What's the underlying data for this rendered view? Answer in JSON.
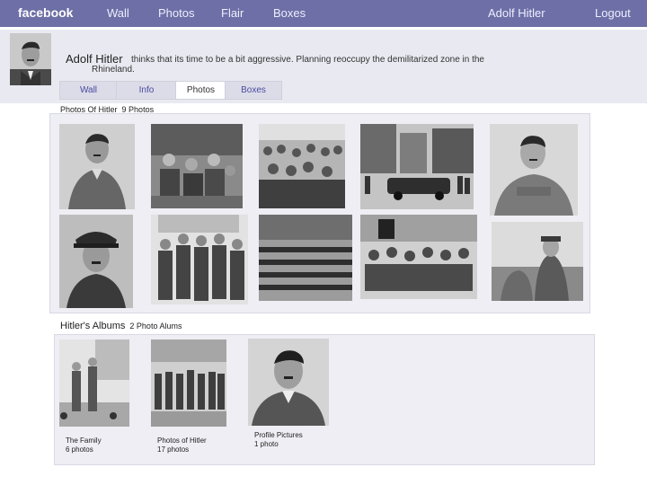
{
  "nav": {
    "brand": "facebook",
    "items": [
      "Wall",
      "Photos",
      "Flair",
      "Boxes"
    ],
    "user": "Adolf Hitler",
    "logout": "Logout"
  },
  "profile": {
    "name": "Adolf Hitler",
    "status_line1": "thinks that its time to be a bit aggressive.  Planning  reoccupy the demilitarized zone in the",
    "status_line2": "Rhineland."
  },
  "profile_tabs": [
    {
      "label": "Wall",
      "active": false
    },
    {
      "label": "Info",
      "active": false
    },
    {
      "label": "Photos",
      "active": true
    },
    {
      "label": "Boxes",
      "active": false
    }
  ],
  "photos_section": {
    "title": "Photos Of Hitler",
    "count": "9 Photos"
  },
  "albums_section": {
    "title": "Hitler's Albums",
    "count": "2 Photo Alums"
  },
  "albums": [
    {
      "name": "The Family",
      "count": "6 photos"
    },
    {
      "name": "Photos of Hitler",
      "count": "17 photos"
    },
    {
      "name": "Profile Pictures",
      "count": "1 photo"
    }
  ],
  "colors": {
    "topbar": "#6d6fa6",
    "panel": "#eeeef4",
    "link": "#4a4aa0"
  }
}
